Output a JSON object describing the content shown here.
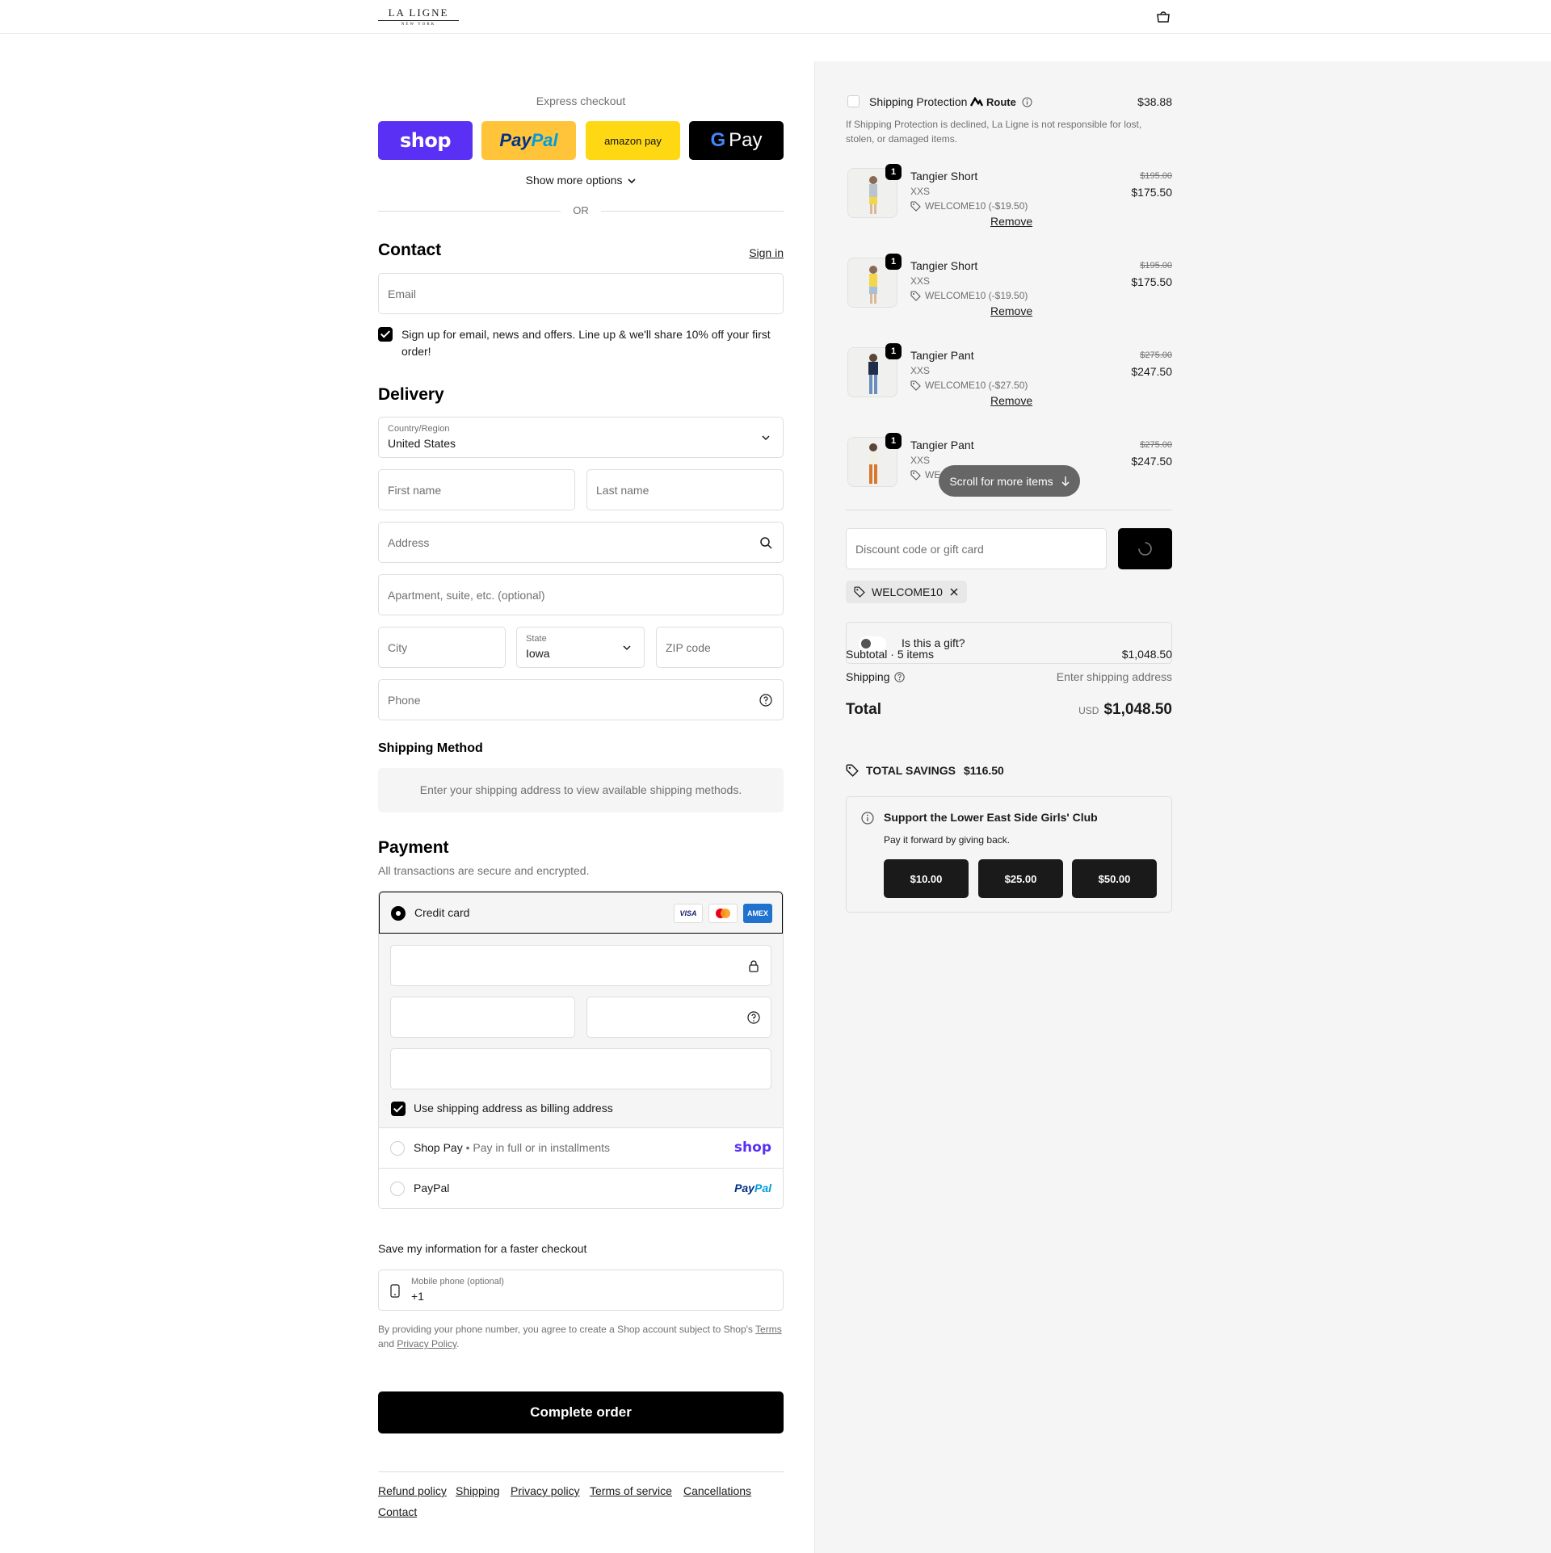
{
  "header": {
    "logo_main": "LA LIGNE",
    "logo_sub": "NEW YORK"
  },
  "express": {
    "title": "Express checkout",
    "shop_label": "shop",
    "paypal_pay": "Pay",
    "paypal_pal": "Pal",
    "amazon_label": "amazon pay",
    "gpay_g": "G",
    "gpay_label": "Pay",
    "show_more": "Show more options",
    "or": "OR"
  },
  "contact": {
    "title": "Contact",
    "sign_in": "Sign in",
    "email_placeholder": "Email",
    "signup_text": "Sign up for email, news and offers. Line up & we'll share 10% off your first order!"
  },
  "delivery": {
    "title": "Delivery",
    "country_label": "Country/Region",
    "country_value": "United States",
    "first_name": "First name",
    "last_name": "Last name",
    "address": "Address",
    "apartment": "Apartment, suite, etc. (optional)",
    "city": "City",
    "state_label": "State",
    "state_value": "Iowa",
    "zip": "ZIP code",
    "phone": "Phone"
  },
  "shipping_method": {
    "title": "Shipping Method",
    "message": "Enter your shipping address to view available shipping methods."
  },
  "payment": {
    "title": "Payment",
    "subtitle": "All transactions are secure and encrypted.",
    "credit_card": "Credit card",
    "visa": "VISA",
    "amex": "AMEX",
    "billing_same": "Use shipping address as billing address",
    "shop_pay": "Shop Pay",
    "shop_pay_sub": "Pay in full or in installments",
    "shop_pay_logo": "shop",
    "paypal": "PayPal",
    "paypal_logo_pay": "Pay",
    "paypal_logo_pal": "Pal"
  },
  "save_info": {
    "title": "Save my information for a faster checkout",
    "mobile_label": "Mobile phone (optional)",
    "mobile_value": "+1",
    "legal_prefix": "By providing your phone number, you agree to create a Shop account subject to Shop's",
    "terms": "Terms",
    "and": "and",
    "privacy": "Privacy Policy",
    "period": "."
  },
  "complete_order": "Complete order",
  "footer_links": [
    "Refund policy",
    "Shipping",
    "Privacy policy",
    "Terms of service",
    "Cancellations",
    "Contact"
  ],
  "summary": {
    "protection_label": "Shipping Protection",
    "route": "Route",
    "protection_price": "$38.88",
    "protection_note": "If Shipping Protection is declined, La Ligne is not responsible for lost, stolen, or damaged items.",
    "items": [
      {
        "qty": "1",
        "name": "Tangier Short",
        "variant": "XXS",
        "discount": "WELCOME10 (-$19.50)",
        "remove": "Remove",
        "old_price": "$195.00",
        "price": "$175.50"
      },
      {
        "qty": "1",
        "name": "Tangier Short",
        "variant": "XXS",
        "discount": "WELCOME10 (-$19.50)",
        "remove": "Remove",
        "old_price": "$195.00",
        "price": "$175.50"
      },
      {
        "qty": "1",
        "name": "Tangier Pant",
        "variant": "XXS",
        "discount": "WELCOME10 (-$27.50)",
        "remove": "Remove",
        "old_price": "$275.00",
        "price": "$247.50"
      },
      {
        "qty": "1",
        "name": "Tangier Pant",
        "variant": "XXS",
        "discount": "WE",
        "old_price": "$275.00",
        "price": "$247.50"
      }
    ],
    "scroll_more": "Scroll for more items",
    "discount_placeholder": "Discount code or gift card",
    "applied_code": "WELCOME10",
    "gift_label": "Is this a gift?",
    "subtotal_label": "Subtotal · 5 items",
    "subtotal_value": "$1,048.50",
    "shipping_label": "Shipping",
    "shipping_value": "Enter shipping address",
    "total_label": "Total",
    "currency": "USD",
    "total_value": "$1,048.50",
    "savings_label": "TOTAL SAVINGS",
    "savings_value": "$116.50",
    "donation_title": "Support the Lower East Side Girls' Club",
    "donation_sub": "Pay it forward by giving back.",
    "donation_amounts": [
      "$10.00",
      "$25.00",
      "$50.00"
    ]
  }
}
